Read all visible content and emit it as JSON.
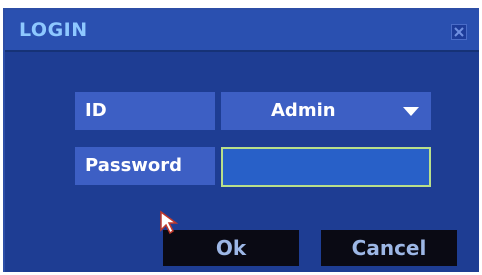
{
  "dialog": {
    "title": "LOGIN",
    "close_icon": "close-icon"
  },
  "form": {
    "id_label": "ID",
    "id_value": "Admin",
    "password_label": "Password",
    "password_value": ""
  },
  "buttons": {
    "ok_label": "Ok",
    "cancel_label": "Cancel"
  },
  "colors": {
    "dialog_bg": "#1f3f8f",
    "titlebar_bg": "#2a50b0",
    "title_text": "#8ec8ff",
    "field_bg": "#3d5fc4",
    "focus_border": "#b9e08a",
    "button_bg": "#0a0a14"
  }
}
